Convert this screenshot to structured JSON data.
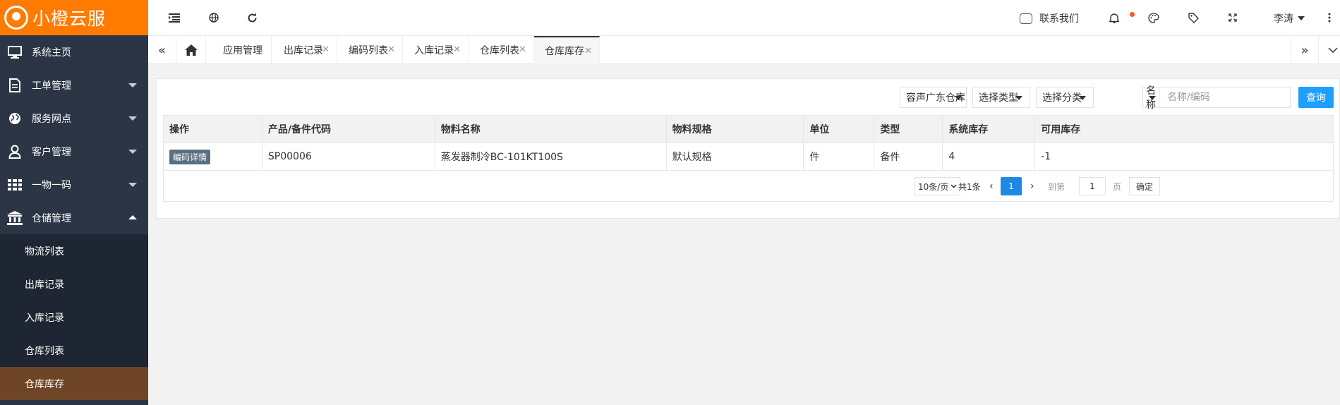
{
  "brand": {
    "name": "小橙云服"
  },
  "sidebar": {
    "items": [
      {
        "label": "系统主页",
        "icon": "monitor-icon"
      },
      {
        "label": "工单管理",
        "icon": "document-icon"
      },
      {
        "label": "服务网点",
        "icon": "globe-icon"
      },
      {
        "label": "客户管理",
        "icon": "user-icon"
      },
      {
        "label": "一物一码",
        "icon": "grid-icon"
      },
      {
        "label": "仓储管理",
        "icon": "bank-icon"
      }
    ],
    "submenu": [
      {
        "label": "物流列表"
      },
      {
        "label": "出库记录"
      },
      {
        "label": "入库记录"
      },
      {
        "label": "仓库列表"
      },
      {
        "label": "仓库库存",
        "active": true
      }
    ]
  },
  "topbar": {
    "contact_label": "联系我们",
    "user_name": "李涛"
  },
  "tabs": [
    {
      "label": "应用管理"
    },
    {
      "label": "出库记录"
    },
    {
      "label": "编码列表"
    },
    {
      "label": "入库记录"
    },
    {
      "label": "仓库列表"
    },
    {
      "label": "仓库库存",
      "active": true
    }
  ],
  "filters": {
    "warehouse": "容声广东仓库",
    "type": "选择类型",
    "category": "选择分类",
    "search_type": "名称",
    "search_placeholder": "名称/编码",
    "query_label": "查询"
  },
  "table": {
    "headers": [
      "操作",
      "产品/备件代码",
      "物料名称",
      "物料规格",
      "单位",
      "类型",
      "系统库存",
      "可用库存"
    ],
    "rows": [
      {
        "action": "编码详情",
        "code": "SP00006",
        "name": "蒸发器制冷BC-101KT100S",
        "spec": "默认规格",
        "unit": "件",
        "type": "备件",
        "system_stock": "4",
        "available_stock": "-1"
      }
    ]
  },
  "pagination": {
    "page_size": "10条/页",
    "total": "共1条",
    "current_page": "1",
    "goto_label": "到第",
    "goto_value": "1",
    "page_suffix": "页",
    "confirm_label": "确定"
  },
  "colors": {
    "brand": "#ff7a00",
    "sidebar": "#2b3546",
    "active_submenu": "#6e4526",
    "primary": "#1e9fff"
  }
}
